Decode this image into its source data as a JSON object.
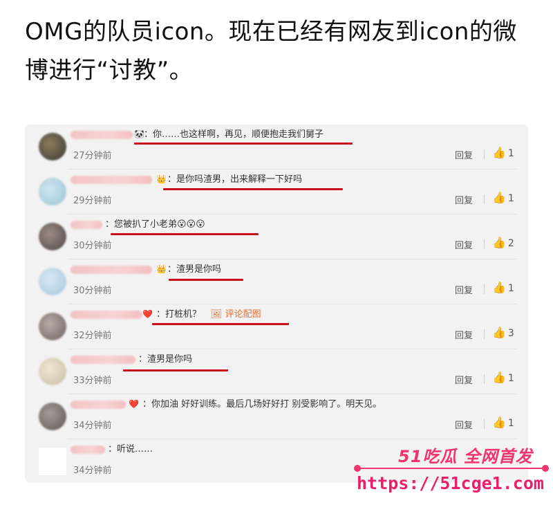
{
  "headline": "OMG的队员icon。现在已经有网友到icon的微博进行“讨教”。",
  "comments": [
    {
      "badge": "🐼",
      "text": "：你……也这样啊，再见，顺便抱走我们舅子",
      "time": "27分钟前",
      "reply": "回复",
      "likes": "1"
    },
    {
      "badge": "👑",
      "text": "：是你吗渣男，出来解释一下好吗",
      "time": "29分钟前",
      "reply": "回复",
      "likes": "1"
    },
    {
      "badge": "",
      "text": "：您被扒了小老弟😮😮😮",
      "time": "30分钟前",
      "reply": "回复",
      "likes": "2"
    },
    {
      "badge": "👑",
      "text": "：渣男是你吗",
      "time": "30分钟前",
      "reply": "回复",
      "likes": "1"
    },
    {
      "badge": "❤️",
      "text": "：打桩机？",
      "link": "🖼 评论配图",
      "time": "32分钟前",
      "reply": "回复",
      "likes": "3"
    },
    {
      "badge": "",
      "text": "：渣男是你吗",
      "time": "33分钟前",
      "reply": "回复",
      "likes": "1"
    },
    {
      "badge": "❤️",
      "text": "：你加油 好好训练。最后几场好好打 别受影响了。明天见。",
      "time": "34分钟前",
      "reply": "回复",
      "likes": "1"
    },
    {
      "badge": "",
      "text": "：听说……",
      "time": "34分钟前",
      "reply": "",
      "likes": ""
    }
  ],
  "watermark": {
    "title": "51吃瓜 全网首发",
    "url": "https://51cge1.com"
  },
  "colors": {
    "underline": "#c8101a",
    "watermark": "#f1346e",
    "card_bg": "#f2f2f2"
  }
}
